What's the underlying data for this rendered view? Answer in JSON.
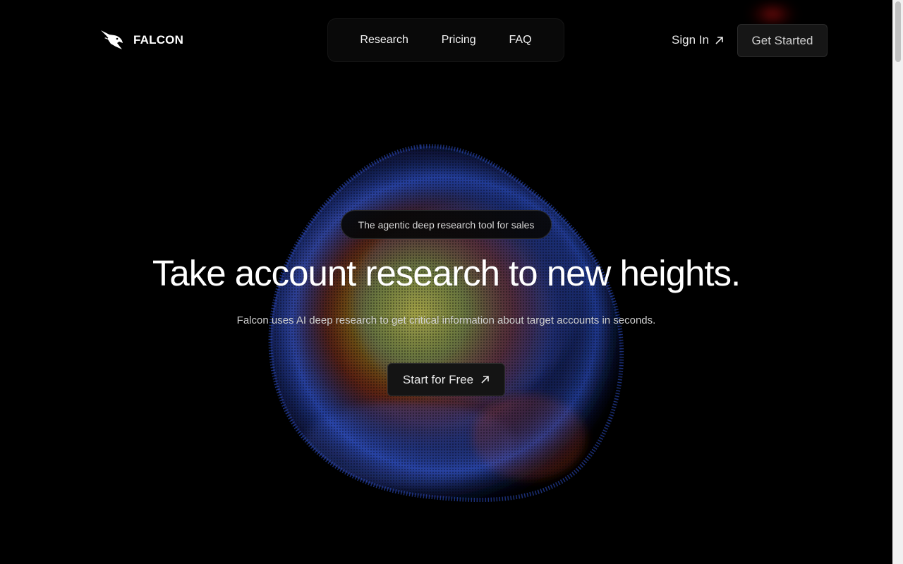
{
  "brand": {
    "name": "FALCON",
    "logo_icon": "falcon-head-icon"
  },
  "nav": {
    "items": [
      {
        "label": "Research"
      },
      {
        "label": "Pricing"
      },
      {
        "label": "FAQ"
      }
    ]
  },
  "header_actions": {
    "sign_in_label": "Sign In",
    "sign_in_icon": "arrow-up-right-icon",
    "get_started_label": "Get Started"
  },
  "hero": {
    "badge": "The agentic deep research tool for sales",
    "headline": "Take account research to new heights.",
    "subheadline": "Falcon uses AI deep research to get critical information about target accounts in seconds.",
    "cta_label": "Start for Free",
    "cta_icon": "arrow-up-right-icon"
  },
  "colors": {
    "background": "#000000",
    "blob_blue": "#2a55c8",
    "blob_yellow": "#b8b020",
    "blob_red": "#c82a14",
    "accent_red_glow": "#c81414"
  }
}
